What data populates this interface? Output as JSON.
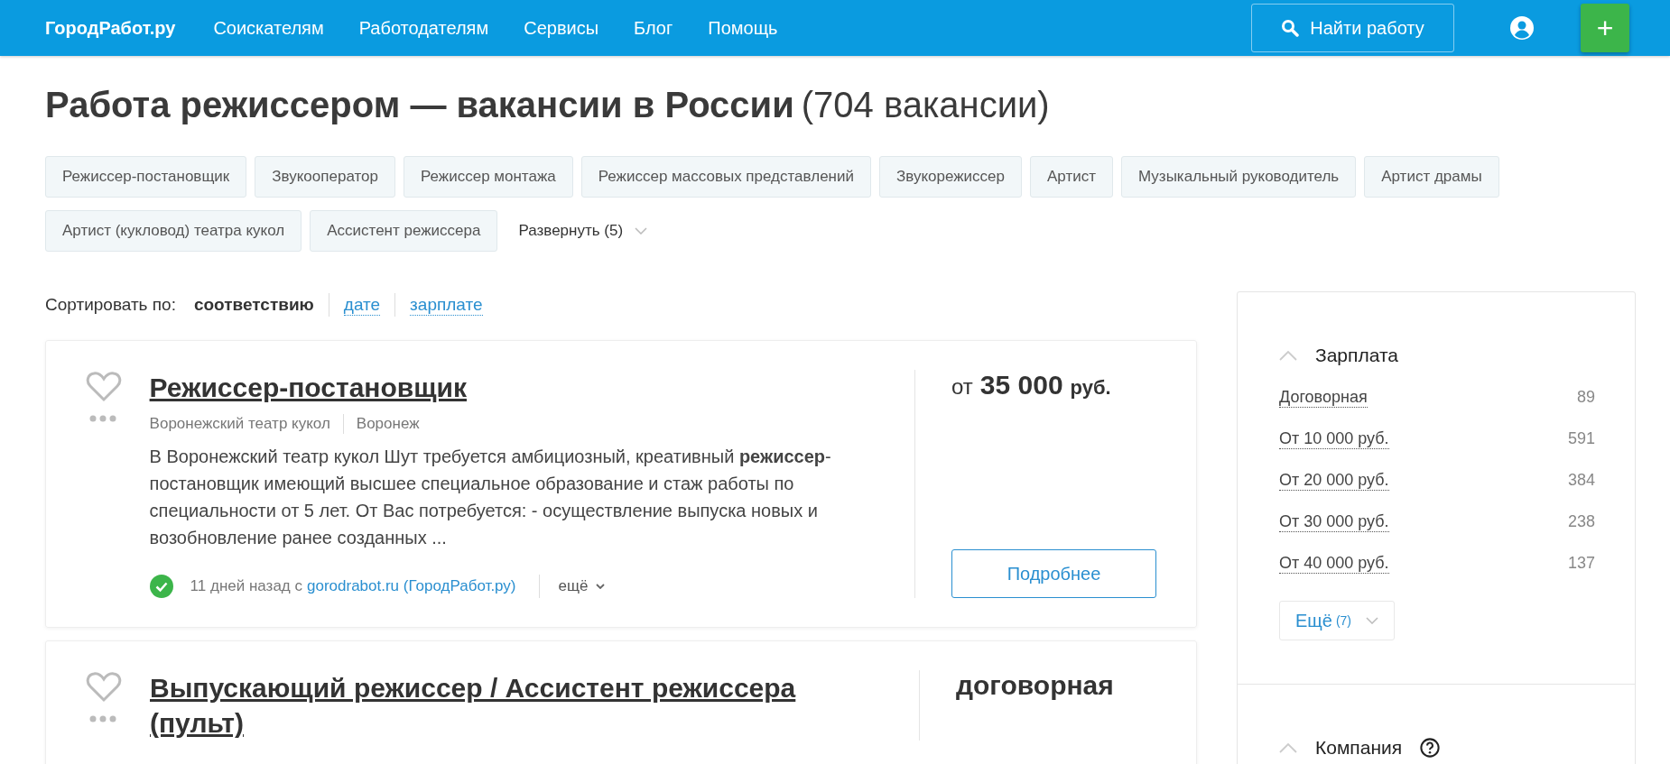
{
  "header": {
    "brand": "ГородРабот.ру",
    "links": [
      "Соискателям",
      "Работодателям",
      "Сервисы",
      "Блог",
      "Помощь"
    ],
    "search_button": "Найти работу",
    "add_button": "+"
  },
  "title": "Работа режиссером — вакансии в России",
  "count": "(704 вакансии)",
  "tags": [
    "Режиссер-постановщик",
    "Звукооператор",
    "Режиссер монтажа",
    "Режиссер массовых представлений",
    "Звукорежиссер",
    "Артист",
    "Музыкальный руководитель",
    "Артист драмы",
    "Артист (кукловод) театра кукол",
    "Ассистент режиссера"
  ],
  "expand": "Развернуть (5)",
  "sort": {
    "label": "Сортировать по:",
    "options": [
      {
        "label": "соответствию",
        "selected": true
      },
      {
        "label": "дате",
        "selected": false
      },
      {
        "label": "зарплате",
        "selected": false
      }
    ]
  },
  "vacancies": [
    {
      "title": "Режиссер-постановщик",
      "salary": {
        "prefix": "от",
        "amount": "35 000",
        "unit": "руб."
      },
      "company": "Воронежский театр кукол",
      "city": "Воронеж",
      "description": "В Воронежский театр кукол Шут требуется амбициозный, креативный **режиссер**-постановщик имеющий высшее специальное образование и стаж работы по специальности от 5 лет. От Вас потребуется: - осуществление выпуска новых и возобновление ранее созданных ...",
      "verified": true,
      "posted": "11 дней назад с",
      "source": "gorodrabot.ru (ГородРабот.ру)",
      "more": "ещё",
      "details_button": "Подробнее"
    },
    {
      "title": "Выпускающий режиссер / Ассистент режиссера (пульт)",
      "salary": {
        "amount": "договорная"
      }
    }
  ],
  "filters": [
    {
      "title": "Зарплата",
      "help": false,
      "items": [
        {
          "label": "Договорная",
          "count": "89"
        },
        {
          "label": "От 10 000 руб.",
          "count": "591"
        },
        {
          "label": "От 20 000 руб.",
          "count": "384"
        },
        {
          "label": "От 30 000 руб.",
          "count": "238"
        },
        {
          "label": "От 40 000 руб.",
          "count": "137"
        }
      ],
      "more": {
        "label": "Ещё",
        "count": "(7)"
      }
    },
    {
      "title": "Компания",
      "help": true
    }
  ]
}
